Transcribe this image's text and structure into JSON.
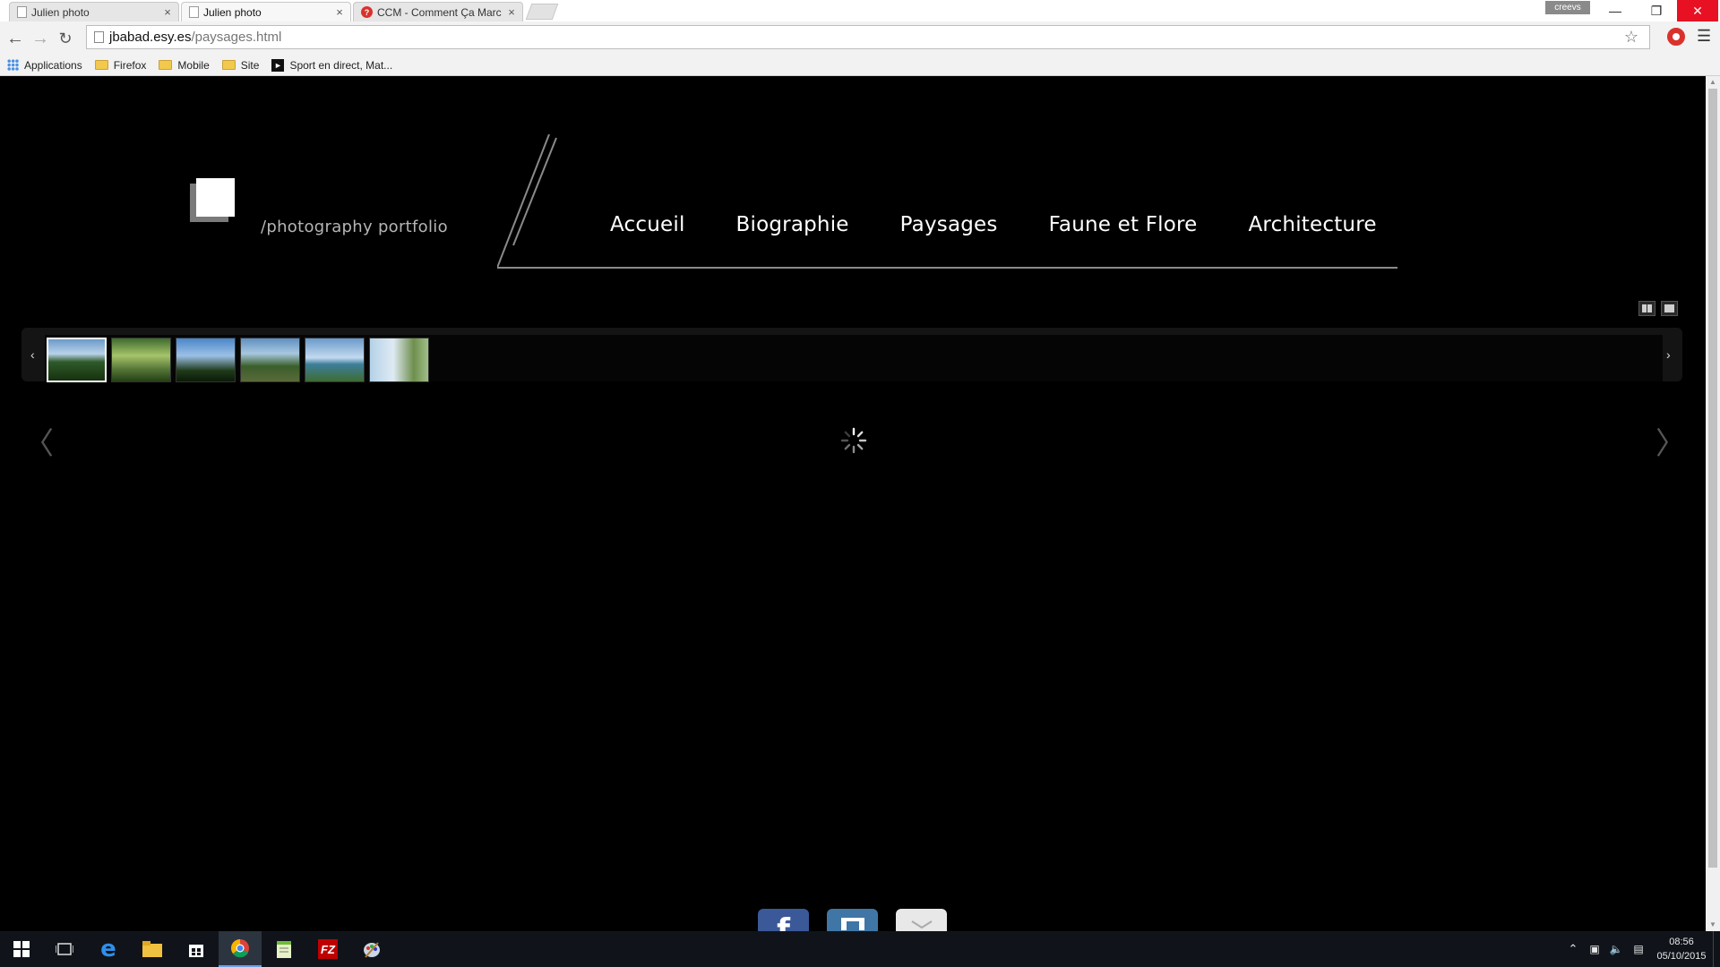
{
  "browser": {
    "tabs": [
      {
        "title": "Julien photo",
        "active": false
      },
      {
        "title": "Julien photo",
        "active": true
      },
      {
        "title": "CCM - Comment Ça Marc",
        "active": false
      }
    ],
    "tab_close_glyph": "×",
    "profile_name": "creevs",
    "url_host": "jbabad.esy.es",
    "url_path": "/paysages.html",
    "bookmarks": [
      {
        "label": "Applications",
        "icon": "apps-icon"
      },
      {
        "label": "Firefox",
        "icon": "folder-icon"
      },
      {
        "label": "Mobile",
        "icon": "folder-icon"
      },
      {
        "label": "Site",
        "icon": "folder-icon"
      },
      {
        "label": "Sport en direct, Mat...",
        "icon": "sport-icon"
      }
    ]
  },
  "site": {
    "tagline": "/photography portfolio",
    "nav": [
      {
        "label": "Accueil"
      },
      {
        "label": "Biographie"
      },
      {
        "label": "Paysages"
      },
      {
        "label": "Faune et Flore"
      },
      {
        "label": "Architecture"
      }
    ],
    "gallery": {
      "thumbnail_count": 6,
      "selected_index": 0,
      "prev_glyph": "‹",
      "next_glyph": "›",
      "big_prev_glyph": "〈",
      "big_next_glyph": "〉"
    },
    "social": [
      {
        "label": "f",
        "icon": "facebook-icon",
        "color": "#3b5998"
      },
      {
        "label": "",
        "icon": "twitter-icon",
        "color": "#3f76a6"
      },
      {
        "label": "",
        "icon": "email-icon",
        "color": "#e8e8e8"
      }
    ]
  },
  "taskbar": {
    "time": "08:56",
    "date": "05/10/2015"
  },
  "colors": {
    "page_background": "#000000",
    "nav_text": "#ffffff",
    "tagline": "#b5b5b5",
    "taskbar": "#10141a"
  }
}
